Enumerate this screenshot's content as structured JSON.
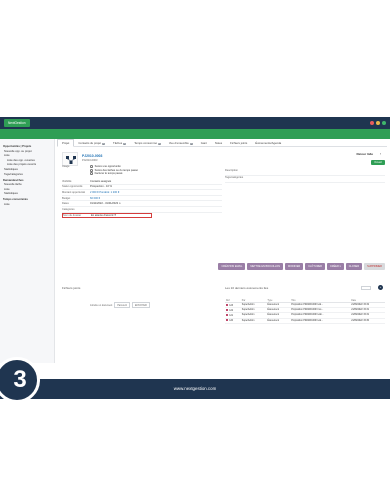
{
  "app": {
    "brand": "NextGestion",
    "dot_colors": [
      "#e85c5c",
      "#e8b84a",
      "#3fb56b"
    ]
  },
  "sidebar": {
    "section1": "Opportunités | Projets",
    "items1": [
      "Nouvelle opp. ou projet",
      "Liste",
      "Liste des opp. ouvertes",
      "Liste des projets ouverts",
      "Statistiques",
      "Tags/catégories"
    ],
    "section2": "Demandes/ches",
    "items2": [
      "Nouvelle tâche",
      "Liste",
      "Statistiques"
    ],
    "section3": "Temps consommés",
    "items3": [
      "Liste"
    ]
  },
  "tabs": [
    {
      "label": "Projet",
      "badge": ""
    },
    {
      "label": "Contacts du projet",
      "badge": "1"
    },
    {
      "label": "Tâches",
      "badge": "1"
    },
    {
      "label": "Temps consommé",
      "badge": "2"
    },
    {
      "label": "Vue d'ensemble",
      "badge": "1"
    },
    {
      "label": "Gant",
      "badge": ""
    },
    {
      "label": "Notes",
      "badge": ""
    },
    {
      "label": "Fichiers joints",
      "badge": ""
    },
    {
      "label": "Événements/Agenda",
      "badge": ""
    }
  ],
  "header": {
    "ref": "PJ2010-0003",
    "sub": "PJ2210-0003",
    "retour": "Retour liste",
    "nav": "‹ ›",
    "status": "Ouvert"
  },
  "usage": {
    "label": "Usage",
    "options": [
      "Suivre une opportunité",
      "Suivre des tâches ou du temps passé",
      "Facturer le temps passé"
    ]
  },
  "fields": [
    {
      "label": "Visibilité",
      "value": "Contacts assignés"
    },
    {
      "label": "Statut opportunité",
      "value": "Prospection - 10 %"
    },
    {
      "label": "Montant opportunité",
      "value": "2 000 €  Pondéré: 1 200 €"
    },
    {
      "label": "Budget",
      "value": "60 000 €"
    },
    {
      "label": "Dates",
      "value": "01/11/2022 - 31/01/2023 ⚠"
    },
    {
      "label": "Catégories",
      "value": ""
    },
    {
      "label": "Nom du dossier",
      "value": "En attente d'accord !!!"
    }
  ],
  "right_fields": [
    "Description",
    "Tags/catégories"
  ],
  "actions": [
    "CRÉATION EMAIL",
    "METTRE EN BROUILLON",
    "MODIFIER",
    "CLÔTURER",
    "CRÉER ▾",
    "CLONER",
    "SUPPRIMER"
  ],
  "pieces": {
    "title": "Fichiers joints",
    "upload_label": "Joindre un document",
    "choose": "Parcourir",
    "send": "ENVOYER"
  },
  "events": {
    "title": "Les 10 derniers événements liés",
    "headers": [
      "Réf",
      "Par",
      "Type",
      "Titre",
      "Date"
    ],
    "rows": [
      [
        "123",
        "SuperAdmin",
        "Événement",
        "Proposition PR2208-0003 val...",
        "21/09/2022 15:32"
      ],
      [
        "122",
        "SuperAdmin",
        "Événement",
        "Proposition PR2208-0003 mo...",
        "21/09/2022 15:31"
      ],
      [
        "121",
        "SuperAdmin",
        "Événement",
        "Proposition PR2208-0003 vali...",
        "21/09/2022 15:31"
      ],
      [
        "120",
        "SuperAdmin",
        "Événement",
        "Proposition PR2208-0003 val...",
        "21/09/2022 15:30"
      ]
    ]
  },
  "footer": {
    "url": "www.nextgestion.com",
    "step": "3"
  }
}
